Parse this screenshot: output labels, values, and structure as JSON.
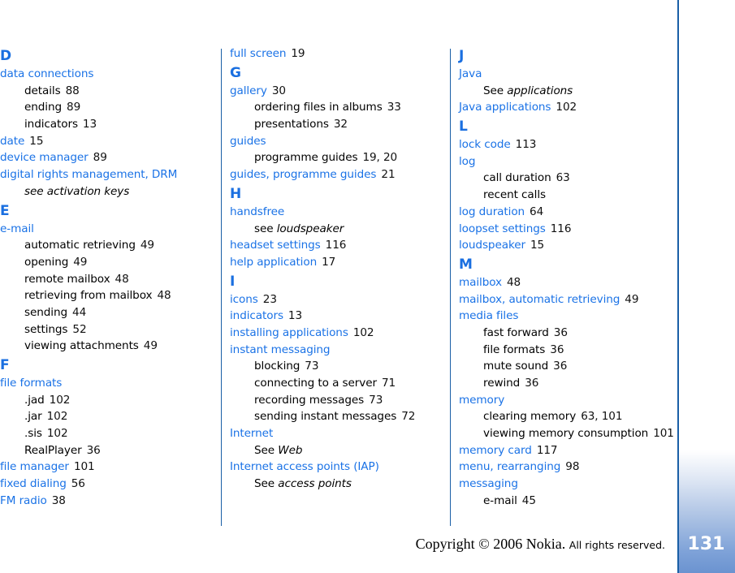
{
  "page": {
    "page_number": "131",
    "copyright_main": "Copyright © 2006 Nokia.",
    "copyright_rights": "All rights reserved.",
    "accent_color": "#1a72e6",
    "divider_color": "#1a5fa6"
  },
  "columns": [
    {
      "entries": [
        {
          "type": "letter",
          "text": "D"
        },
        {
          "type": "main",
          "term": "data connections",
          "pages": ""
        },
        {
          "type": "sub",
          "term": "details",
          "pages": "88"
        },
        {
          "type": "sub",
          "term": "ending",
          "pages": "89"
        },
        {
          "type": "sub",
          "term": "indicators",
          "pages": "13"
        },
        {
          "type": "main",
          "term": "date",
          "pages": "15"
        },
        {
          "type": "main",
          "term": "device manager",
          "pages": "89"
        },
        {
          "type": "main",
          "term": "digital rights management, DRM",
          "pages": ""
        },
        {
          "type": "see",
          "prefix": "see activation keys",
          "target": ""
        },
        {
          "type": "letter",
          "text": "E"
        },
        {
          "type": "main",
          "term": "e-mail",
          "pages": ""
        },
        {
          "type": "sub",
          "term": "automatic retrieving",
          "pages": "49"
        },
        {
          "type": "sub",
          "term": "opening",
          "pages": "49"
        },
        {
          "type": "sub",
          "term": "remote mailbox",
          "pages": "48"
        },
        {
          "type": "sub",
          "term": "retrieving from mailbox",
          "pages": "48"
        },
        {
          "type": "sub",
          "term": "sending",
          "pages": "44"
        },
        {
          "type": "sub",
          "term": "settings",
          "pages": "52"
        },
        {
          "type": "sub",
          "term": "viewing attachments",
          "pages": "49"
        },
        {
          "type": "letter",
          "text": "F"
        },
        {
          "type": "main",
          "term": "file formats",
          "pages": ""
        },
        {
          "type": "sub",
          "term": ".jad",
          "pages": "102"
        },
        {
          "type": "sub",
          "term": ".jar",
          "pages": "102"
        },
        {
          "type": "sub",
          "term": ".sis",
          "pages": "102"
        },
        {
          "type": "sub",
          "term": "RealPlayer",
          "pages": "36"
        },
        {
          "type": "main",
          "term": "file manager",
          "pages": "101"
        },
        {
          "type": "main",
          "term": "fixed dialing",
          "pages": "56"
        },
        {
          "type": "main",
          "term": "FM radio",
          "pages": "38"
        }
      ]
    },
    {
      "entries": [
        {
          "type": "main",
          "term": "full screen",
          "pages": "19"
        },
        {
          "type": "letter",
          "text": "G"
        },
        {
          "type": "main",
          "term": "gallery",
          "pages": "30"
        },
        {
          "type": "sub",
          "term": "ordering files in albums",
          "pages": "33"
        },
        {
          "type": "sub",
          "term": "presentations",
          "pages": "32"
        },
        {
          "type": "main",
          "term": "guides",
          "pages": ""
        },
        {
          "type": "sub",
          "term": "programme guides",
          "pages": "19, 20"
        },
        {
          "type": "main",
          "term": "guides, programme guides",
          "pages": "21"
        },
        {
          "type": "letter",
          "text": "H"
        },
        {
          "type": "main",
          "term": "handsfree",
          "pages": ""
        },
        {
          "type": "see",
          "prefix": "see",
          "target": "loudspeaker"
        },
        {
          "type": "main",
          "term": "headset settings",
          "pages": "116"
        },
        {
          "type": "main",
          "term": "help application",
          "pages": "17"
        },
        {
          "type": "letter",
          "text": "I"
        },
        {
          "type": "main",
          "term": "icons",
          "pages": "23"
        },
        {
          "type": "main",
          "term": "indicators",
          "pages": "13"
        },
        {
          "type": "main",
          "term": "installing applications",
          "pages": "102"
        },
        {
          "type": "main",
          "term": "instant messaging",
          "pages": ""
        },
        {
          "type": "sub",
          "term": "blocking",
          "pages": "73"
        },
        {
          "type": "sub",
          "term": "connecting to a server",
          "pages": "71"
        },
        {
          "type": "sub",
          "term": "recording messages",
          "pages": "73"
        },
        {
          "type": "sub",
          "term": "sending instant messages",
          "pages": "72"
        },
        {
          "type": "main",
          "term": "Internet",
          "pages": ""
        },
        {
          "type": "see",
          "prefix": "See",
          "target": "Web"
        },
        {
          "type": "main",
          "term": "Internet access points (IAP)",
          "pages": ""
        },
        {
          "type": "see",
          "prefix": "See",
          "target": "access points"
        }
      ]
    },
    {
      "entries": [
        {
          "type": "letter",
          "text": "J"
        },
        {
          "type": "main",
          "term": "Java",
          "pages": ""
        },
        {
          "type": "see",
          "prefix": "See",
          "target": "applications"
        },
        {
          "type": "main",
          "term": "Java applications",
          "pages": "102"
        },
        {
          "type": "letter",
          "text": "L"
        },
        {
          "type": "main",
          "term": "lock code",
          "pages": "113"
        },
        {
          "type": "main",
          "term": "log",
          "pages": ""
        },
        {
          "type": "sub",
          "term": "call duration",
          "pages": "63"
        },
        {
          "type": "sub",
          "term": "recent calls",
          "pages": ""
        },
        {
          "type": "main",
          "term": "log duration",
          "pages": "64"
        },
        {
          "type": "main",
          "term": "loopset settings",
          "pages": "116"
        },
        {
          "type": "main",
          "term": "loudspeaker",
          "pages": "15"
        },
        {
          "type": "letter",
          "text": "M"
        },
        {
          "type": "main",
          "term": "mailbox",
          "pages": "48"
        },
        {
          "type": "main",
          "term": "mailbox, automatic retrieving",
          "pages": "49"
        },
        {
          "type": "main",
          "term": "media files",
          "pages": ""
        },
        {
          "type": "sub",
          "term": "fast forward",
          "pages": "36"
        },
        {
          "type": "sub",
          "term": "file formats",
          "pages": "36"
        },
        {
          "type": "sub",
          "term": "mute sound",
          "pages": "36"
        },
        {
          "type": "sub",
          "term": "rewind",
          "pages": "36"
        },
        {
          "type": "main",
          "term": "memory",
          "pages": ""
        },
        {
          "type": "sub",
          "term": "clearing memory",
          "pages": "63, 101"
        },
        {
          "type": "sub",
          "term": "viewing memory consumption",
          "pages": "101"
        },
        {
          "type": "main",
          "term": "memory card",
          "pages": "117"
        },
        {
          "type": "main",
          "term": "menu, rearranging",
          "pages": "98"
        },
        {
          "type": "main",
          "term": "messaging",
          "pages": ""
        },
        {
          "type": "sub",
          "term": "e-mail",
          "pages": "45"
        }
      ]
    }
  ]
}
